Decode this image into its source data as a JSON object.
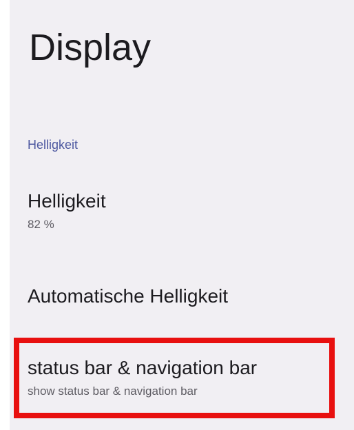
{
  "page": {
    "title": "Display"
  },
  "section": {
    "header": "Helligkeit"
  },
  "preferences": [
    {
      "title": "Helligkeit",
      "summary": "82 %"
    },
    {
      "title": "Automatische Helligkeit"
    },
    {
      "title": "status bar & navigation bar",
      "summary": "show status bar & navigation bar"
    }
  ],
  "highlight": {
    "color": "#e8100f"
  }
}
